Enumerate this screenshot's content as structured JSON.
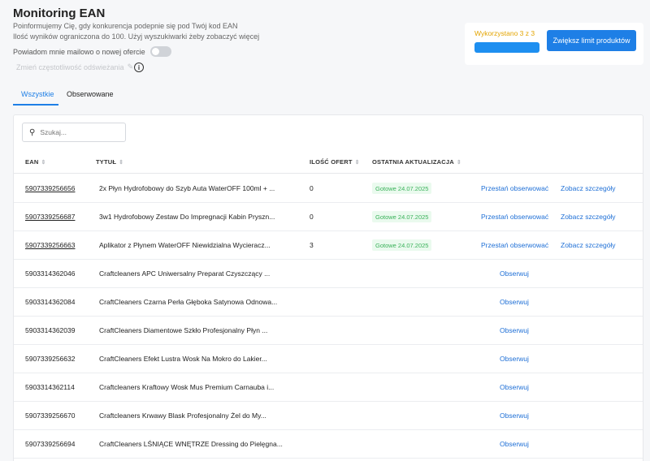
{
  "header": {
    "title": "Monitoring EAN",
    "subtitle_1": "Poinformujemy Cię, gdy konkurencja podepnie się pod Twój kod EAN",
    "subtitle_2": "Ilość wyników ograniczona do 100. Użyj wyszukiwarki żeby zobaczyć więcej",
    "notify_label": "Powiadom mnie mailowo o nowej ofercie",
    "notify_toggle_on": false,
    "frequency_label": "Zmień częstotliwość odświeżania",
    "info_glyph": "i"
  },
  "limit": {
    "used_text": "Wykorzystano 3 z 3",
    "used_fraction": 1.0,
    "button_label": "Zwiększ limit produktów"
  },
  "tabs": [
    {
      "label": "Wszystkie",
      "active": true
    },
    {
      "label": "Obserwowane",
      "active": false
    }
  ],
  "search": {
    "placeholder": "Szukaj..."
  },
  "table": {
    "columns": [
      "EAN",
      "TYTUŁ",
      "ILOŚĆ OFERT",
      "OSTATNIA AKTUALIZACJA"
    ],
    "rows": [
      {
        "ean": "5907339256656",
        "title": "2x Płyn Hydrofobowy do Szyb Auta WaterOFF 100ml + ...",
        "offers": "0",
        "status": "Gotowe 24.07.2025",
        "action_1": "Przestań obserwować",
        "action_2": "Zobacz szczegóły",
        "watched": true
      },
      {
        "ean": "5907339256687",
        "title": "3w1 Hydrofobowy Zestaw Do Impregnacji Kabin Pryszn...",
        "offers": "0",
        "status": "Gotowe 24.07.2025",
        "action_1": "Przestań obserwować",
        "action_2": "Zobacz szczegóły",
        "watched": true
      },
      {
        "ean": "5907339256663",
        "title": "Aplikator z Płynem WaterOFF Niewidzialna Wycieracz...",
        "offers": "3",
        "status": "Gotowe 24.07.2025",
        "action_1": "Przestań obserwować",
        "action_2": "Zobacz szczegóły",
        "watched": true
      },
      {
        "ean": "5903314362046",
        "title": "Craftcleaners APC Uniwersalny Preparat Czyszczący ...",
        "action_1": "Obserwuj",
        "watched": false
      },
      {
        "ean": "5903314362084",
        "title": "CraftCleaners Czarna Perła Głęboka Satynowa Odnowa...",
        "action_1": "Obserwuj",
        "watched": false
      },
      {
        "ean": "5903314362039",
        "title": "CraftCleaners Diamentowe Szkło Profesjonalny Płyn ...",
        "action_1": "Obserwuj",
        "watched": false
      },
      {
        "ean": "5907339256632",
        "title": "CraftCleaners Efekt Lustra Wosk Na Mokro do Lakier...",
        "action_1": "Obserwuj",
        "watched": false
      },
      {
        "ean": "5903314362114",
        "title": "Craftcleaners Kraftowy Wosk Mus Premium Carnauba i...",
        "action_1": "Obserwuj",
        "watched": false
      },
      {
        "ean": "5907339256670",
        "title": "Craftcleaners Krwawy Blask Profesjonalny Żel do My...",
        "action_1": "Obserwuj",
        "watched": false
      },
      {
        "ean": "5907339256694",
        "title": "CraftCleaners LŚNIĄCE WNĘTRZE Dressing do Pielęgna...",
        "action_1": "Obserwuj",
        "watched": false
      }
    ]
  },
  "icons": {
    "search": "search-icon",
    "edit": "pencil-icon",
    "info": "info-icon",
    "sort": "sort-icon"
  },
  "colors": {
    "accent": "#1e7fe6",
    "warning": "#e3a400",
    "success": "#3bb25b"
  }
}
